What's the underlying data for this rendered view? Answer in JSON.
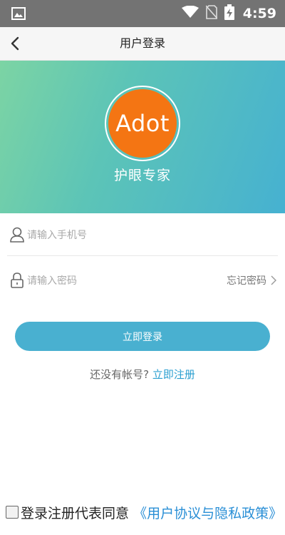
{
  "status_bar": {
    "time": "4:59",
    "icons": [
      "image-icon",
      "wifi-icon",
      "no-sim-icon",
      "battery-charging-icon"
    ]
  },
  "nav": {
    "title": "用户登录",
    "back_icon": "chevron-left-icon"
  },
  "hero": {
    "logo_text": "Adot",
    "app_name": "护眼专家",
    "colors": {
      "gradient_start": "#7cd4a4",
      "gradient_end": "#46b1d1",
      "logo_bg": "#f47513"
    }
  },
  "form": {
    "phone_placeholder": "请输入手机号",
    "password_placeholder": "请输入密码",
    "forgot_label": "忘记密码",
    "login_label": "立即登录",
    "no_account_text": "还没有帐号?",
    "register_label": "立即注册",
    "accent": "#49b0d0"
  },
  "agreement": {
    "text": "登录注册代表同意",
    "policy_link": "《用户协议与隐私政策》",
    "checked": false
  }
}
